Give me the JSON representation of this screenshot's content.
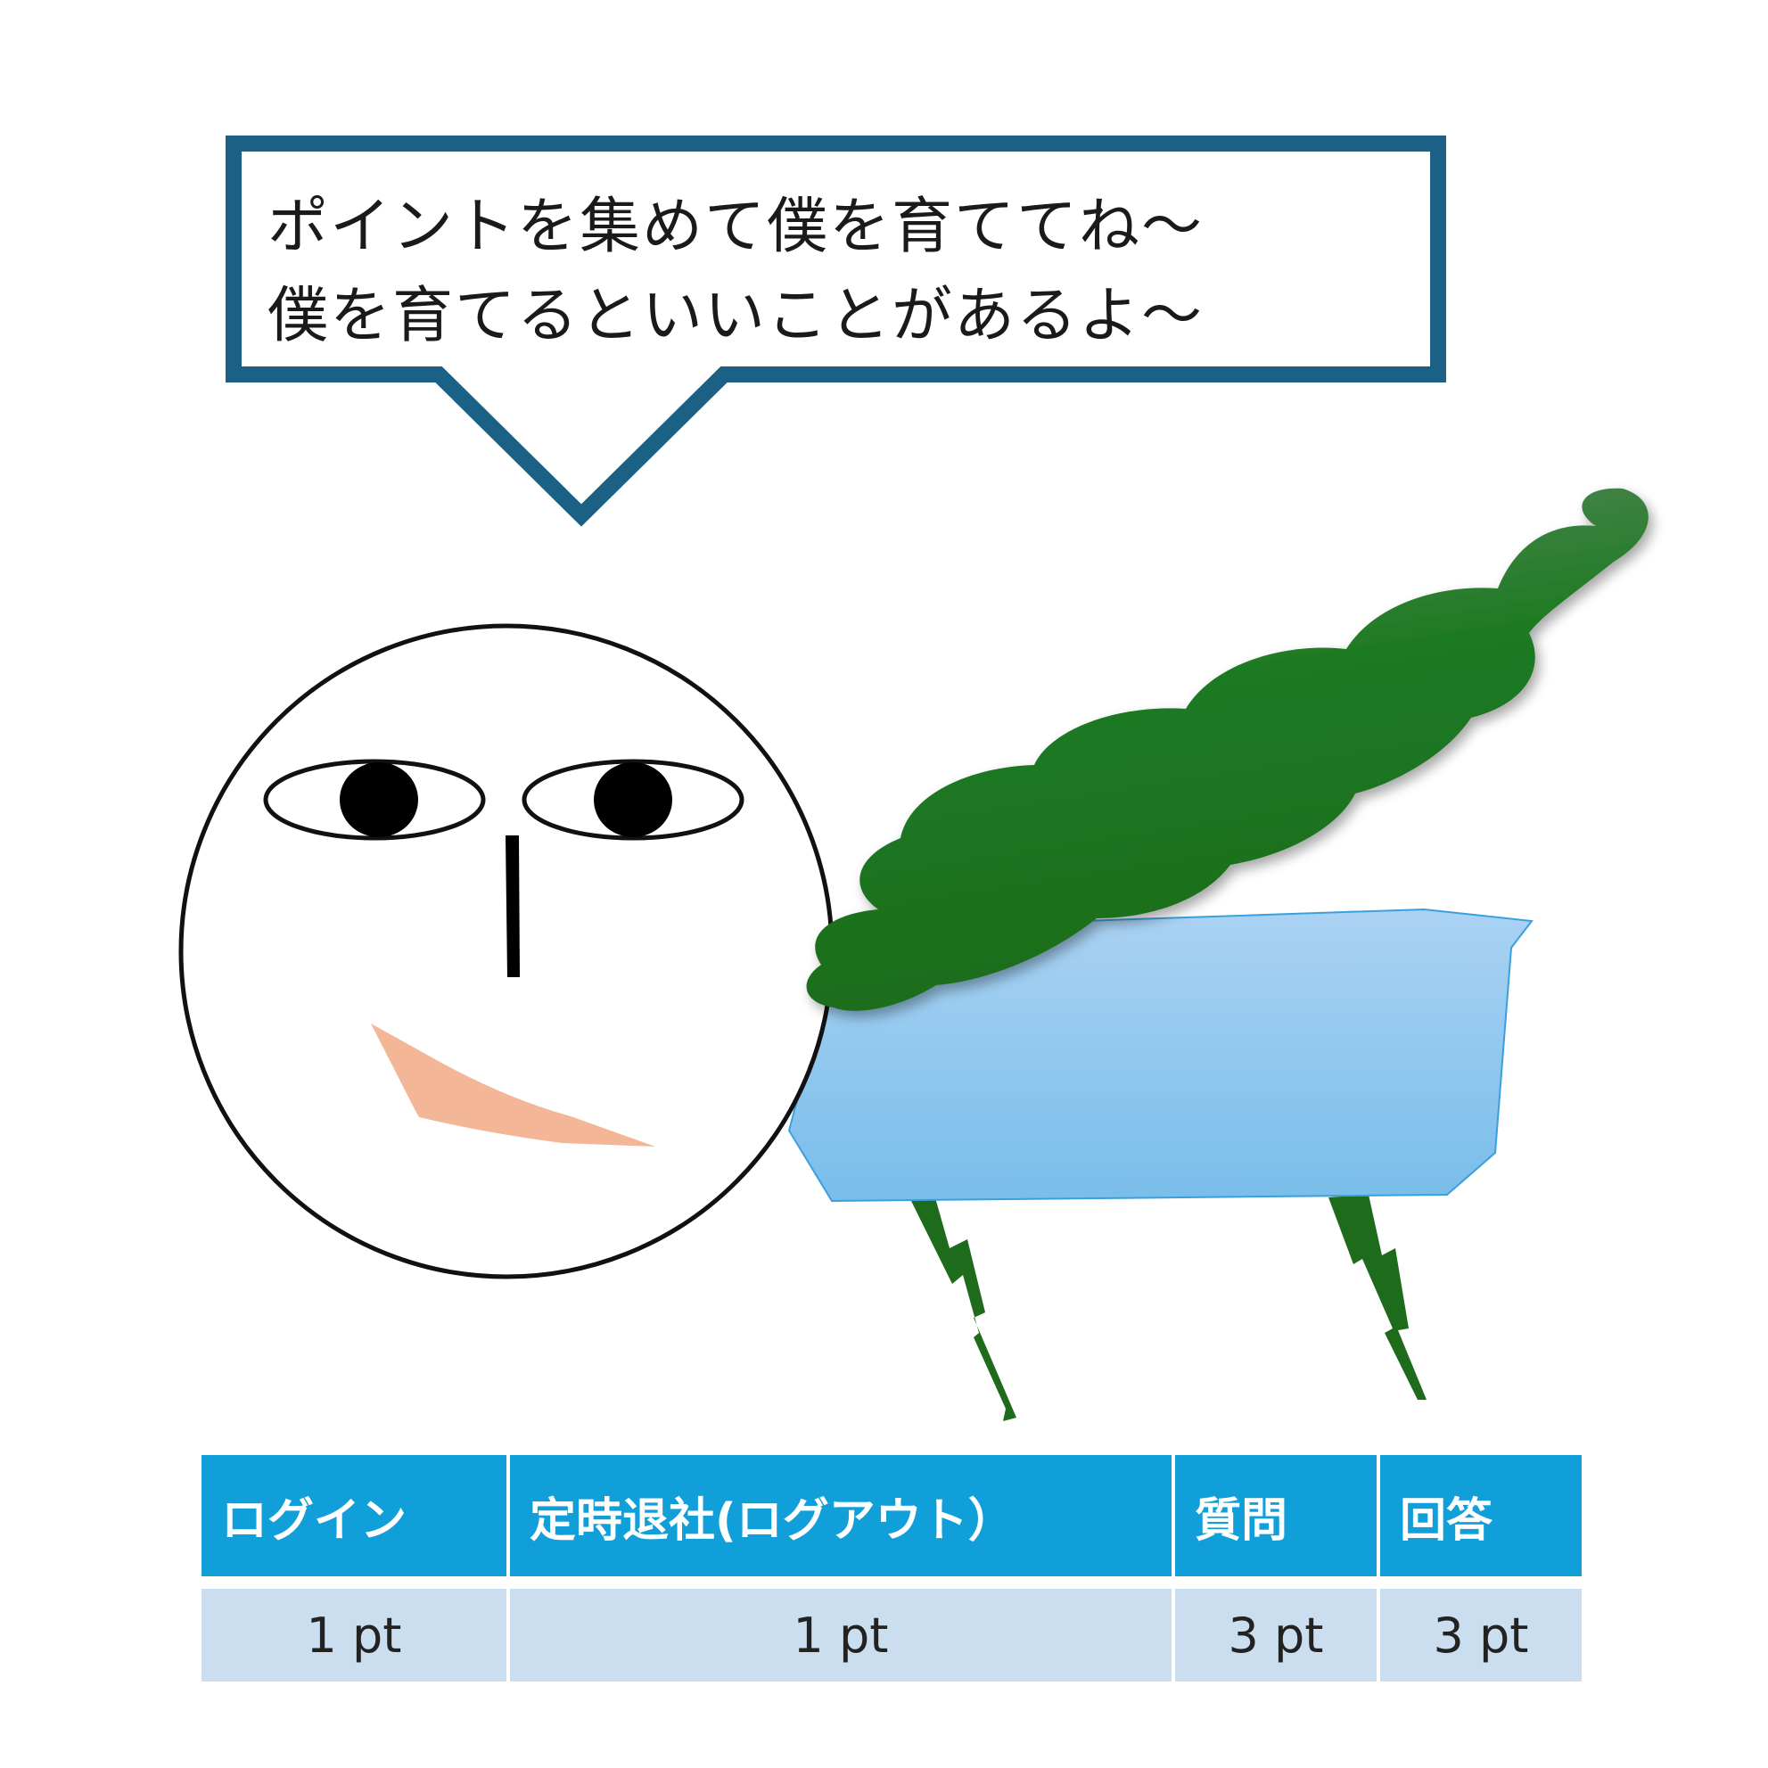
{
  "speech_bubble": {
    "lines": [
      "ポイントを集めて僕を育ててね～",
      "僕を育てるといいことがあるよ～"
    ]
  },
  "colors": {
    "bubble_border": "#1a6185",
    "cloud_green": "#1e7a22",
    "body_blue": "#8cc3ec",
    "leg_green": "#1e6b1c",
    "mouth_peach": "#f3b798",
    "table_header": "#119fd9",
    "table_row": "#cadeef"
  },
  "points_table": {
    "headers": [
      "ログイン",
      "定時退社(ログアウト）",
      "質問",
      "回答"
    ],
    "values": [
      "1 pt",
      "1 pt",
      "3 pt",
      "3 pt"
    ]
  }
}
